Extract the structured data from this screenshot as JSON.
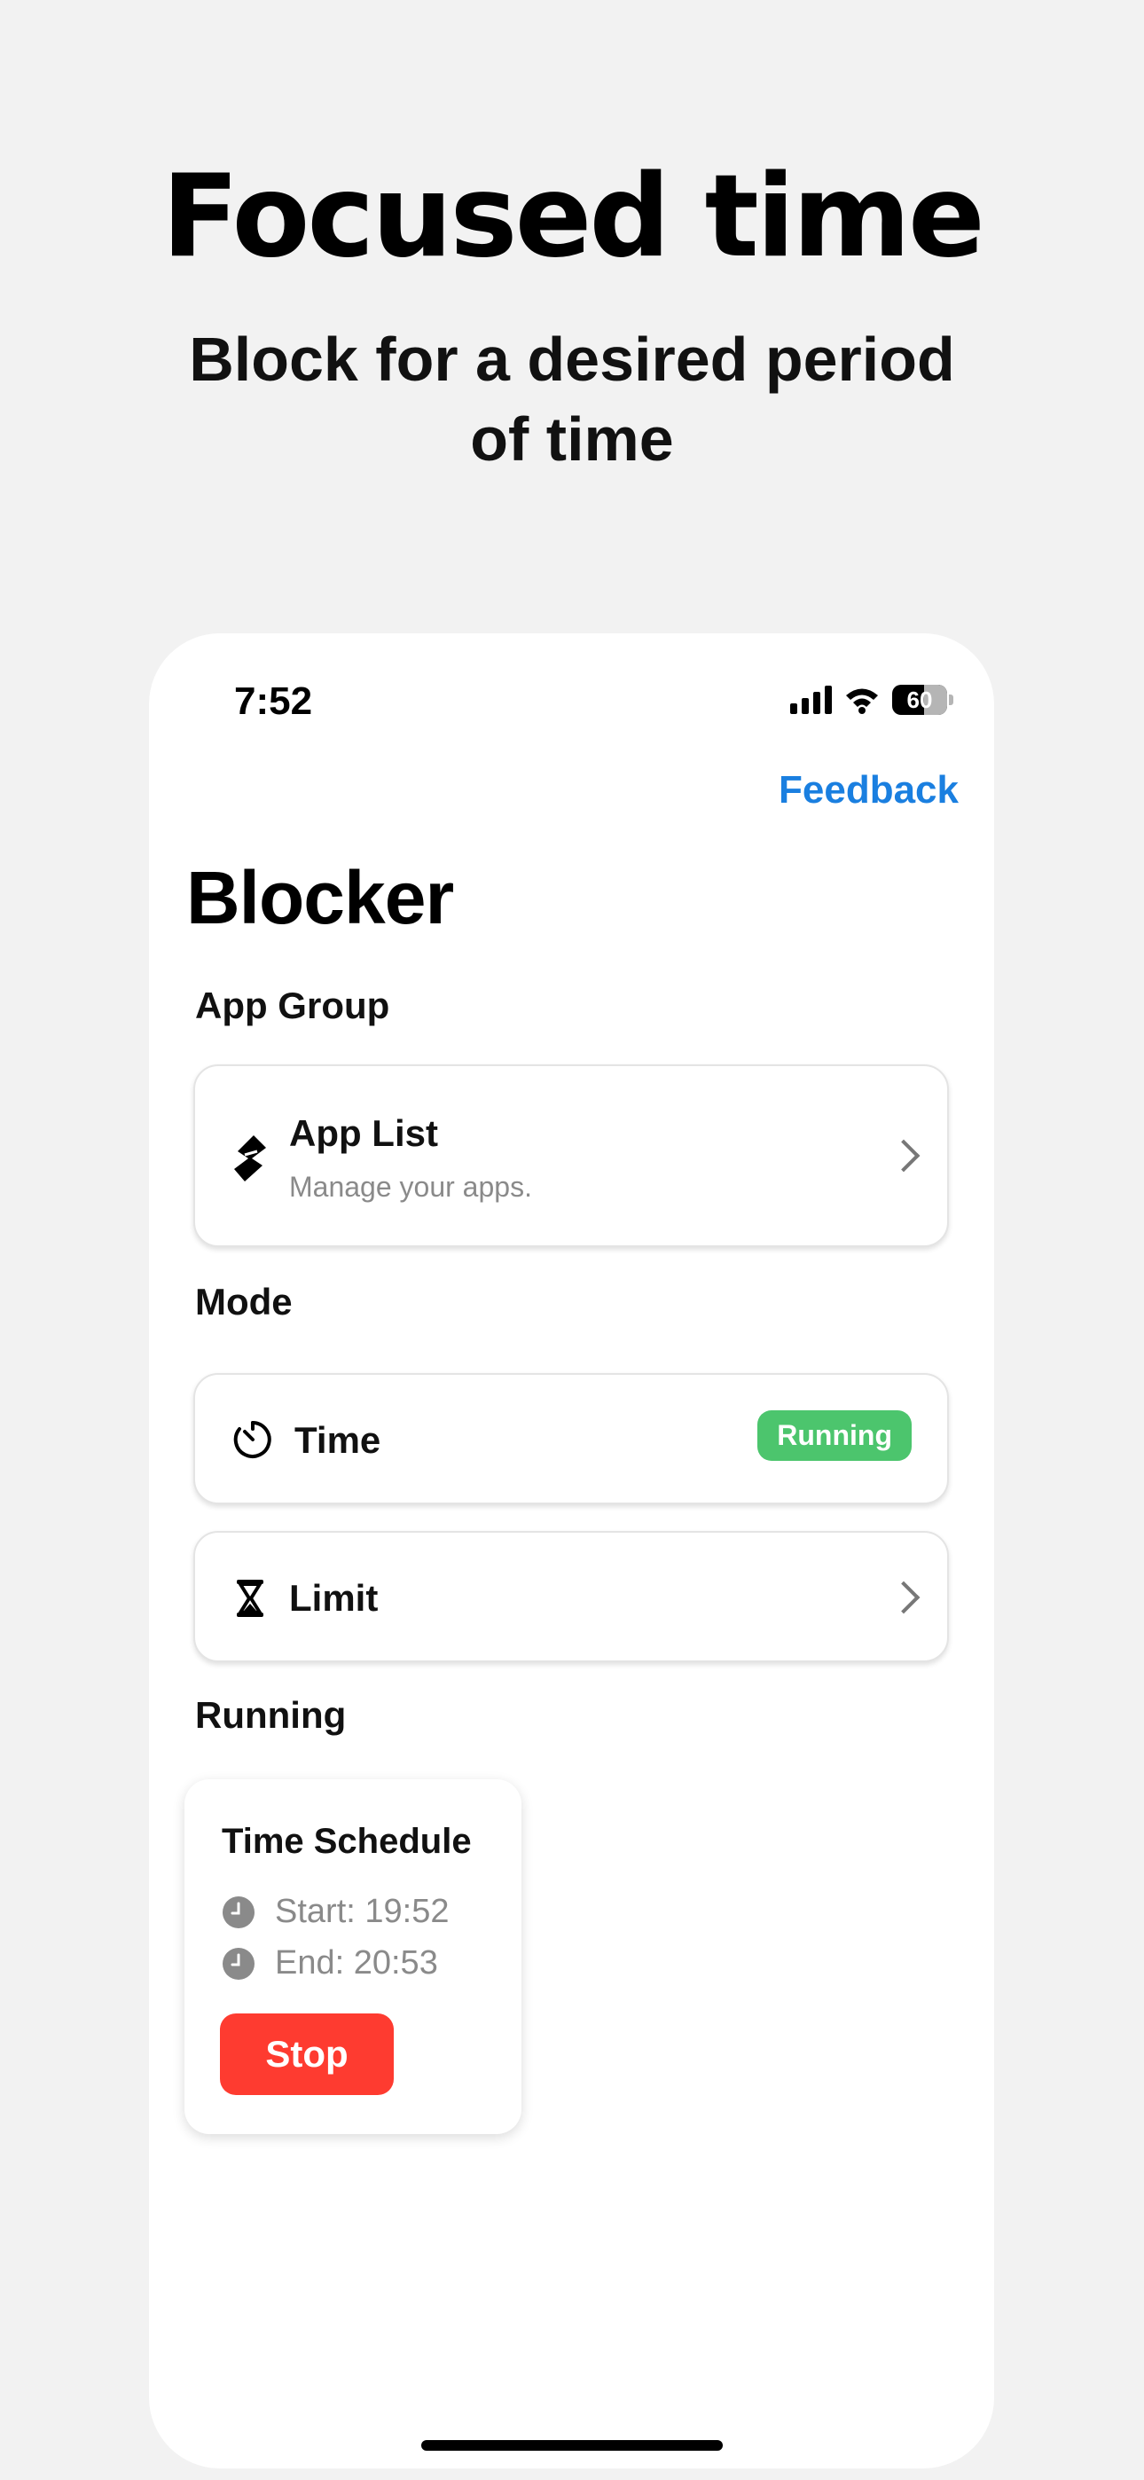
{
  "promo": {
    "headline": "Focused time",
    "subheadline": "Block for a desired period of time"
  },
  "status_bar": {
    "time": "7:52",
    "battery": "60",
    "icons": [
      "cellular-signal-icon",
      "wifi-icon",
      "battery-icon"
    ]
  },
  "nav": {
    "feedback_label": "Feedback"
  },
  "screen": {
    "title": "Blocker"
  },
  "app_group": {
    "section_label": "App Group",
    "item": {
      "icon": "apps-icon",
      "title": "App List",
      "subtitle": "Manage your apps."
    }
  },
  "mode": {
    "section_label": "Mode",
    "items": [
      {
        "icon": "timer-icon",
        "title": "Time",
        "badge": "Running"
      },
      {
        "icon": "hourglass-icon",
        "title": "Limit"
      }
    ]
  },
  "running": {
    "section_label": "Running",
    "schedule": {
      "title": "Time Schedule",
      "start": "Start: 19:52",
      "end": "End: 20:53",
      "stop_label": "Stop"
    }
  },
  "colors": {
    "background": "#f2f2f2",
    "accent_blue": "#1a7fe0",
    "running_green": "#4cc56d",
    "stop_red": "#fe3b30"
  }
}
